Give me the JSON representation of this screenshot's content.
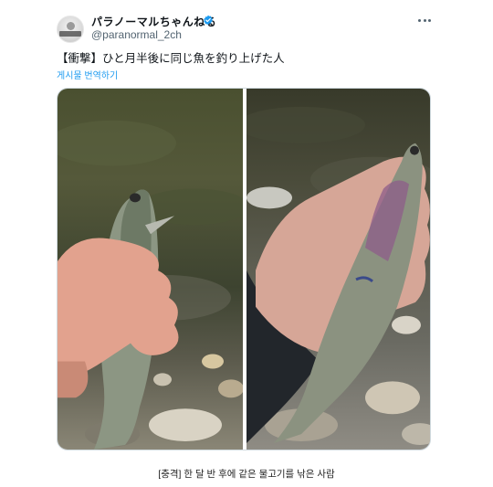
{
  "account": {
    "display_name": "パラノーマルちゃんねる",
    "handle": "@paranormal_2ch",
    "avatar_icon": "avatar-logo-icon",
    "verified_color": "#1d9bf0"
  },
  "tweet": {
    "text": "【衝撃】ひと月半後に同じ魚を釣り上げた人",
    "translate_link": "게시물 번역하기",
    "more_icon": "more-options-icon"
  },
  "media": {
    "photos": [
      {
        "description_icon": "fish-photo-1"
      },
      {
        "description_icon": "fish-photo-2"
      }
    ]
  },
  "caption": "[충격] 한 달 반 후에 같은 물고기를 낚은 사람"
}
